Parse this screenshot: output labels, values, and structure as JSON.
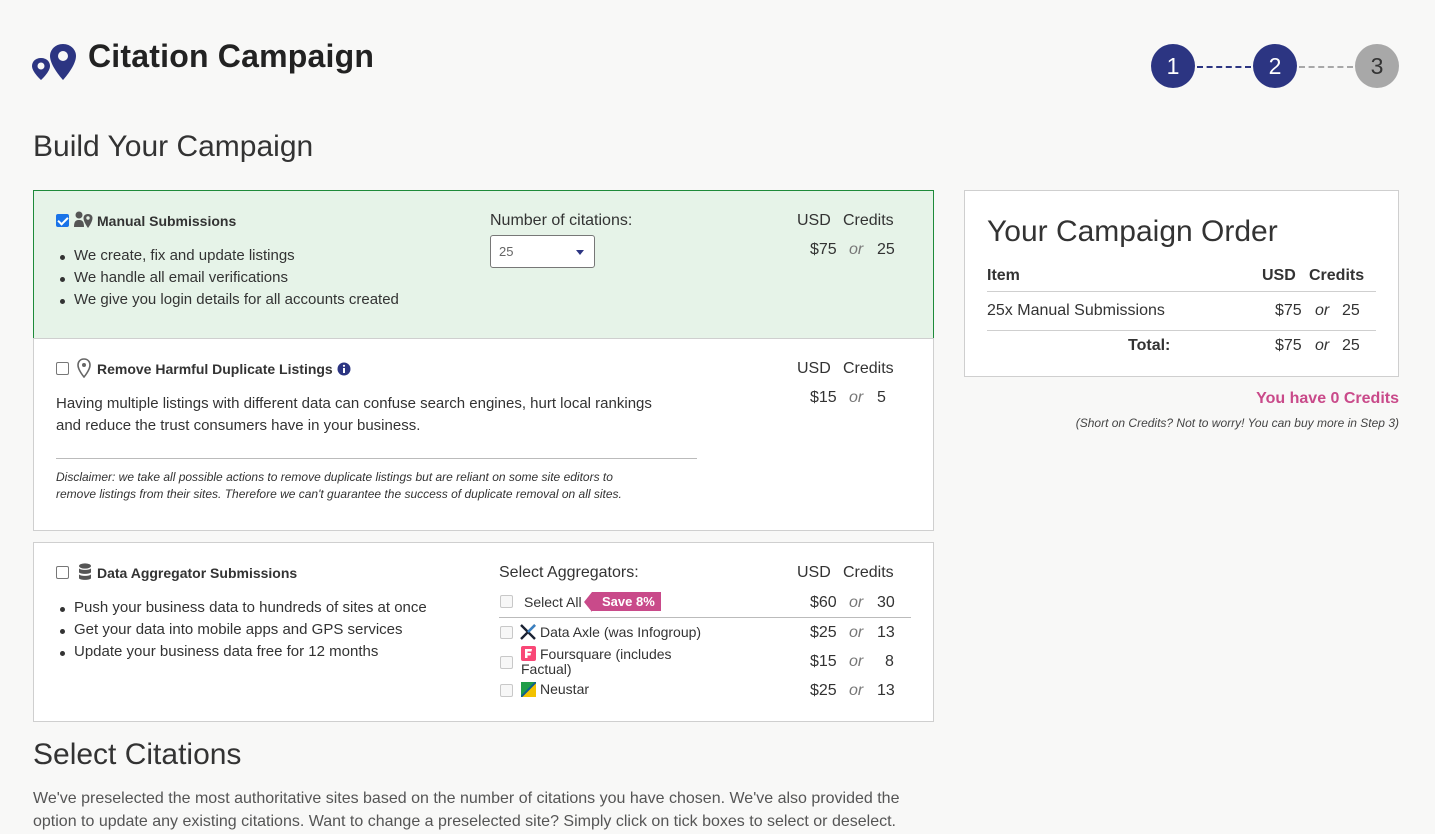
{
  "app": {
    "title": "Citation Campaign",
    "logo_icon": "map-pins-icon"
  },
  "stepper": {
    "steps": [
      {
        "label": "1",
        "state": "active"
      },
      {
        "label": "2",
        "state": "active"
      },
      {
        "label": "3",
        "state": "inactive"
      }
    ],
    "colors": {
      "active": "#2c3582",
      "inactive": "#a8a8a8"
    }
  },
  "page_heading": "Build Your Campaign",
  "manual": {
    "title": "Manual Submissions",
    "checked": true,
    "icon": "person-pin-icon",
    "bullets": [
      "We create, fix and update listings",
      "We handle all email verifications",
      "We give you login details for all accounts created"
    ],
    "count_label": "Number of citations:",
    "count_value": "25",
    "usd_head": "USD",
    "credits_head": "Credits",
    "usd": "$75",
    "or": "or",
    "credits": "25"
  },
  "duplicates": {
    "title": "Remove Harmful Duplicate Listings",
    "checked": false,
    "icon": "pin-icon",
    "info_icon": "info-icon",
    "usd_head": "USD",
    "credits_head": "Credits",
    "usd": "$15",
    "or": "or",
    "credits": "5",
    "description_1": "Having multiple listings with different data can confuse search engines, hurt local rankings",
    "description_2": "and reduce the trust consumers have in your business.",
    "disclaimer_1": "Disclaimer: we take all possible actions to remove duplicate listings but are reliant on some site editors to",
    "disclaimer_2": "remove listings from their sites. Therefore we can't guarantee the success of duplicate removal on all sites."
  },
  "aggregators": {
    "title": "Data Aggregator Submissions",
    "checked": false,
    "icon": "database-icon",
    "bullets": [
      "Push your business data to hundreds of sites at once",
      "Get your data into mobile apps and GPS services",
      "Update your business data free for 12 months"
    ],
    "select_label": "Select Aggregators:",
    "usd_head": "USD",
    "credits_head": "Credits",
    "select_all": {
      "label": "Select All",
      "badge": "Save 8%",
      "usd": "$60",
      "or": "or",
      "credits": "30"
    },
    "items": [
      {
        "name": "Data Axle (was Infogroup)",
        "icon": "data-axle-logo-icon",
        "usd": "$25",
        "or": "or",
        "credits": "13"
      },
      {
        "name_1": "Foursquare (includes",
        "name_2": "Factual)",
        "icon": "foursquare-logo-icon",
        "usd": "$15",
        "or": "or",
        "credits": "8"
      },
      {
        "name": "Neustar",
        "icon": "neustar-logo-icon",
        "usd": "$25",
        "or": "or",
        "credits": "13"
      }
    ]
  },
  "order": {
    "title": "Your Campaign Order",
    "col_item": "Item",
    "col_usd": "USD",
    "col_credits": "Credits",
    "line_item": "25x Manual Submissions",
    "line_usd": "$75",
    "line_or": "or",
    "line_credits": "25",
    "total_label": "Total:",
    "total_usd": "$75",
    "total_or": "or",
    "total_credits": "25"
  },
  "credits_note": "You have 0 Credits",
  "credits_sub": "(Short on Credits? Not to worry! You can buy more in Step 3)",
  "select_citations": {
    "heading": "Select Citations",
    "description_1": "We've preselected the most authoritative sites based on the number of citations you have chosen. We've also provided the",
    "description_2": "option to update any existing citations. Want to change a preselected site? Simply click on tick boxes to select or deselect."
  },
  "colors": {
    "accent": "#2c3582",
    "selected_bg": "#e6f3e8",
    "selected_border": "#1e8a3a",
    "pink": "#c94a8a"
  }
}
